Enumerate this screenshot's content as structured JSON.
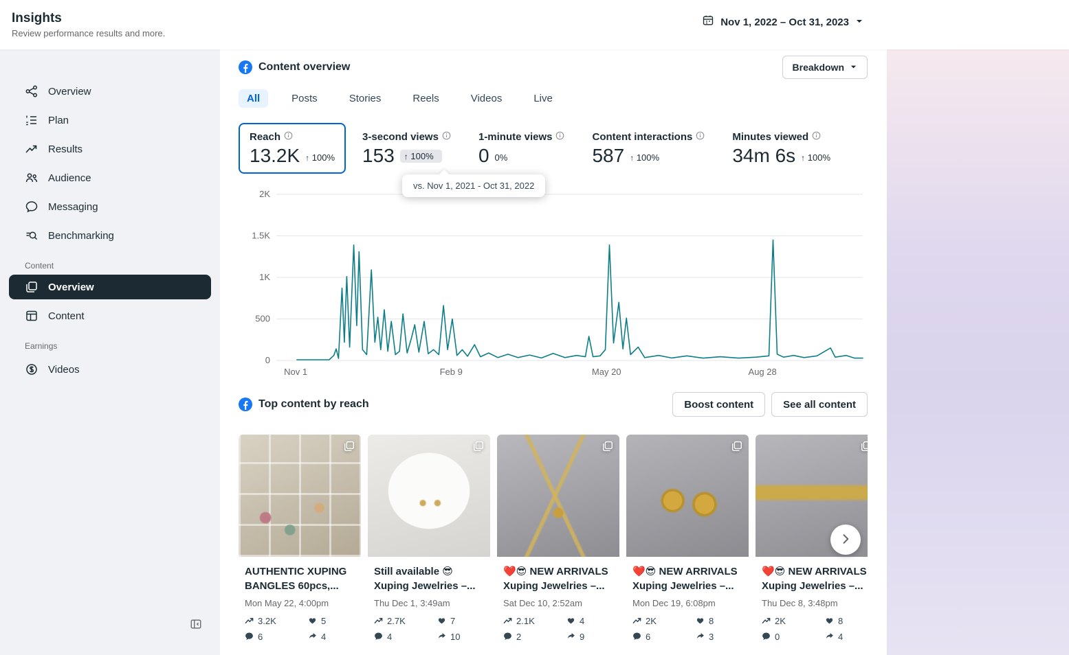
{
  "header": {
    "title": "Insights",
    "subtitle": "Review performance results and more.",
    "date_range": "Nov 1, 2022 – Oct 31, 2023"
  },
  "sidebar": {
    "main_items": [
      {
        "label": "Overview"
      },
      {
        "label": "Plan"
      },
      {
        "label": "Results"
      },
      {
        "label": "Audience"
      },
      {
        "label": "Messaging"
      },
      {
        "label": "Benchmarking"
      }
    ],
    "sections": [
      {
        "label": "Content",
        "items": [
          {
            "label": "Overview",
            "selected": true
          },
          {
            "label": "Content",
            "selected": false
          }
        ]
      },
      {
        "label": "Earnings",
        "items": [
          {
            "label": "Videos",
            "selected": false
          }
        ]
      }
    ]
  },
  "content_overview": {
    "title": "Content overview",
    "breakdown_label": "Breakdown",
    "tabs": [
      "All",
      "Posts",
      "Stories",
      "Reels",
      "Videos",
      "Live"
    ],
    "active_tab": "All",
    "metrics": [
      {
        "label": "Reach",
        "value": "13.2K",
        "arrow": "↑",
        "change": "100%"
      },
      {
        "label": "3-second views",
        "value": "153",
        "arrow": "↑",
        "change": "100%"
      },
      {
        "label": "1-minute views",
        "value": "0",
        "arrow": "",
        "change": "0%"
      },
      {
        "label": "Content interactions",
        "value": "587",
        "arrow": "↑",
        "change": "100%"
      },
      {
        "label": "Minutes viewed",
        "value": "34m 6s",
        "arrow": "↑",
        "change": "100%"
      }
    ],
    "comparison_tooltip": "vs. Nov 1, 2021 - Oct 31, 2022"
  },
  "chart_data": {
    "type": "line",
    "metric": "Reach",
    "line_color": "#0d7e87",
    "grid": true,
    "ymax": 2000,
    "ylim": [
      0,
      2000
    ],
    "yticks": [
      {
        "value": 2000,
        "label": "2K"
      },
      {
        "value": 1500,
        "label": "1.5K"
      },
      {
        "value": 1000,
        "label": "1K"
      },
      {
        "value": 500,
        "label": "500"
      },
      {
        "value": 0,
        "label": "0"
      }
    ],
    "xticks": [
      {
        "label": "Nov 1",
        "frac": 0.033
      },
      {
        "label": "Feb 9",
        "frac": 0.298
      },
      {
        "label": "May 20",
        "frac": 0.563
      },
      {
        "label": "Aug 28",
        "frac": 0.829
      }
    ],
    "x_range": [
      "Nov 1, 2022",
      "Oct 31, 2023"
    ],
    "points": [
      [
        0.035,
        8
      ],
      [
        0.07,
        8
      ],
      [
        0.09,
        8
      ],
      [
        0.098,
        60
      ],
      [
        0.102,
        140
      ],
      [
        0.106,
        25
      ],
      [
        0.112,
        870
      ],
      [
        0.116,
        220
      ],
      [
        0.12,
        1010
      ],
      [
        0.125,
        160
      ],
      [
        0.132,
        1390
      ],
      [
        0.137,
        420
      ],
      [
        0.141,
        1310
      ],
      [
        0.147,
        130
      ],
      [
        0.154,
        70
      ],
      [
        0.162,
        1090
      ],
      [
        0.168,
        220
      ],
      [
        0.173,
        520
      ],
      [
        0.178,
        130
      ],
      [
        0.184,
        610
      ],
      [
        0.19,
        110
      ],
      [
        0.196,
        470
      ],
      [
        0.203,
        70
      ],
      [
        0.21,
        110
      ],
      [
        0.216,
        560
      ],
      [
        0.223,
        90
      ],
      [
        0.23,
        260
      ],
      [
        0.236,
        430
      ],
      [
        0.243,
        100
      ],
      [
        0.252,
        470
      ],
      [
        0.259,
        80
      ],
      [
        0.268,
        130
      ],
      [
        0.277,
        70
      ],
      [
        0.285,
        660
      ],
      [
        0.292,
        130
      ],
      [
        0.3,
        500
      ],
      [
        0.308,
        60
      ],
      [
        0.317,
        130
      ],
      [
        0.326,
        50
      ],
      [
        0.338,
        190
      ],
      [
        0.348,
        45
      ],
      [
        0.362,
        90
      ],
      [
        0.378,
        35
      ],
      [
        0.395,
        75
      ],
      [
        0.412,
        35
      ],
      [
        0.432,
        65
      ],
      [
        0.452,
        30
      ],
      [
        0.472,
        85
      ],
      [
        0.492,
        35
      ],
      [
        0.512,
        60
      ],
      [
        0.527,
        45
      ],
      [
        0.533,
        290
      ],
      [
        0.54,
        45
      ],
      [
        0.552,
        55
      ],
      [
        0.561,
        130
      ],
      [
        0.568,
        1390
      ],
      [
        0.575,
        210
      ],
      [
        0.584,
        700
      ],
      [
        0.591,
        140
      ],
      [
        0.597,
        510
      ],
      [
        0.604,
        70
      ],
      [
        0.617,
        160
      ],
      [
        0.628,
        35
      ],
      [
        0.652,
        60
      ],
      [
        0.674,
        30
      ],
      [
        0.7,
        55
      ],
      [
        0.728,
        28
      ],
      [
        0.757,
        45
      ],
      [
        0.788,
        28
      ],
      [
        0.818,
        40
      ],
      [
        0.84,
        55
      ],
      [
        0.847,
        1450
      ],
      [
        0.854,
        75
      ],
      [
        0.865,
        40
      ],
      [
        0.882,
        60
      ],
      [
        0.9,
        35
      ],
      [
        0.922,
        55
      ],
      [
        0.945,
        150
      ],
      [
        0.953,
        40
      ],
      [
        0.972,
        60
      ],
      [
        0.986,
        28
      ],
      [
        1.0,
        28
      ]
    ]
  },
  "top_content": {
    "title": "Top content by reach",
    "boost_button": "Boost content",
    "see_all_button": "See all content",
    "cards": [
      {
        "title": "AUTHENTIC XUPING BANGLES 60pcs,...",
        "date": "Mon May 22, 4:00pm",
        "reach": "3.2K",
        "likes": "5",
        "comments": "6",
        "shares": "4"
      },
      {
        "title": "Still available 😎 Xuping Jewelries –...",
        "date": "Thu Dec 1, 3:49am",
        "reach": "2.7K",
        "likes": "7",
        "comments": "4",
        "shares": "10"
      },
      {
        "title": "❤️😎 NEW ARRIVALS Xuping Jewelries –...",
        "date": "Sat Dec 10, 2:52am",
        "reach": "2.1K",
        "likes": "4",
        "comments": "2",
        "shares": "9"
      },
      {
        "title": "❤️😎 NEW ARRIVALS Xuping Jewelries –...",
        "date": "Mon Dec 19, 6:08pm",
        "reach": "2K",
        "likes": "8",
        "comments": "6",
        "shares": "3"
      },
      {
        "title": "❤️😎 NEW ARRIVALS Xuping Jewelries –...",
        "date": "Thu Dec 8, 3:48pm",
        "reach": "2K",
        "likes": "8",
        "comments": "0",
        "shares": "4"
      }
    ]
  }
}
